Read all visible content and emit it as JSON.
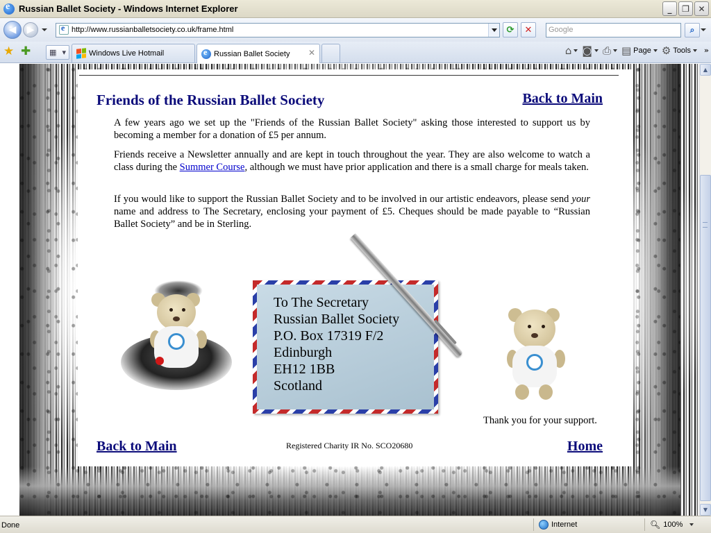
{
  "window": {
    "title": "Russian Ballet Society - Windows Internet Explorer"
  },
  "address_bar": {
    "url": "http://www.russianballetsociety.co.uk/frame.html",
    "search_placeholder": "Google"
  },
  "tabs": [
    {
      "label": "Windows Live Hotmail"
    },
    {
      "label": "Russian Ballet Society",
      "active": true
    }
  ],
  "command_bar": {
    "page_label": "Page",
    "tools_label": "Tools"
  },
  "page": {
    "heading": "Friends of the Russian Ballet Society",
    "back_to_main_top": "Back to Main",
    "para1": "A few years ago we set up the \"Friends of the Russian Ballet Society\" asking those interested to support us by becoming a member for a donation of £5 per annum.",
    "para2_before": "Friends receive a Newsletter annually and are kept in touch throughout the year.  They are also welcome to watch a class during the ",
    "para2_link": "Summer Course",
    "para2_after": ", although we must have prior application and there is a small charge for meals taken.",
    "para3_before": "If you would like to support the Russian Ballet Society and to be involved in our artistic endeavors, please send ",
    "para3_em": "your",
    "para3_after": " name and address to The Secretary, enclosing your payment of £5.  Cheques should be made payable to “Russian Ballet Society” and be in Sterling.",
    "envelope": [
      "To The Secretary",
      "Russian Ballet Society",
      "P.O. Box 17319 F/2",
      "Edinburgh",
      "EH12 1BB",
      "Scotland"
    ],
    "thanks": "Thank you for your support.",
    "back_to_main_bottom": "Back to Main",
    "charity": "Registered Charity IR No. SCO20680",
    "home": "Home"
  },
  "status_bar": {
    "status": "Done",
    "zone": "Internet",
    "zoom": "100%"
  }
}
